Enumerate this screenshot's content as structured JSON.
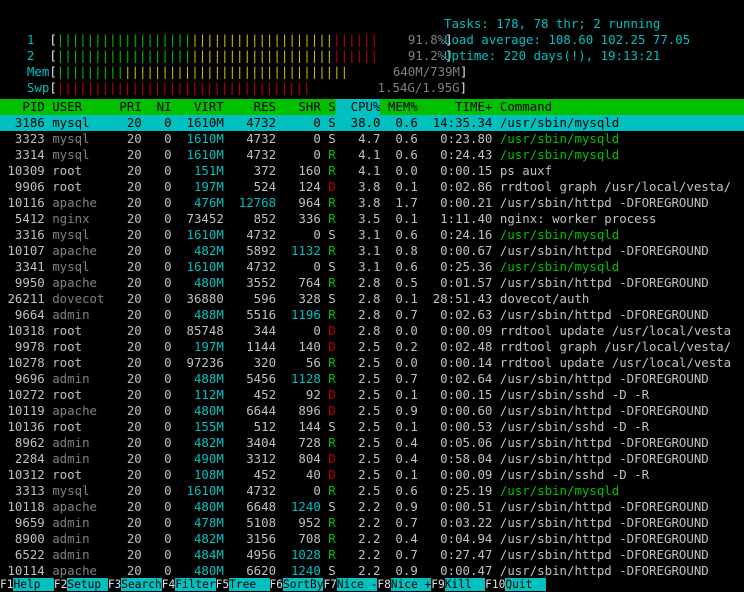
{
  "meters": {
    "cpu1": {
      "label": "1",
      "value": "91.8%",
      "fraction": 0.918
    },
    "cpu2": {
      "label": "2",
      "value": "91.2%",
      "fraction": 0.912
    },
    "mem": {
      "label": "Mem",
      "value": "640M/739M",
      "fraction": 0.866
    },
    "swp": {
      "label": "Swp",
      "value": "1.54G/1.95G",
      "fraction": 0.79
    }
  },
  "summary": {
    "tasks": "Tasks: 178, 78 thr; 2 running",
    "load": "Load average: 108.60 102.25 77.05",
    "uptime": "Uptime: 220 days(!), 19:13:21"
  },
  "columns": [
    "PID",
    "USER",
    "PRI",
    "NI",
    "VIRT",
    "RES",
    "SHR",
    "S",
    "CPU%",
    "MEM%",
    "TIME+",
    "Command"
  ],
  "processes": [
    {
      "pid": "3186",
      "user": "mysql",
      "pri": "20",
      "ni": "0",
      "virt": "1610M",
      "res": "4732",
      "shr": "0",
      "s": "S",
      "cpu": "38.0",
      "mem": "0.6",
      "time": "14:35.34",
      "cmd": "/usr/sbin/mysqld",
      "selected": true
    },
    {
      "pid": "3323",
      "user": "mysql",
      "pri": "20",
      "ni": "0",
      "virt": "1610M",
      "res": "4732",
      "shr": "0",
      "s": "S",
      "cpu": "4.7",
      "mem": "0.6",
      "time": "0:23.80",
      "cmd": "/usr/sbin/mysqld",
      "thread": true
    },
    {
      "pid": "3314",
      "user": "mysql",
      "pri": "20",
      "ni": "0",
      "virt": "1610M",
      "res": "4732",
      "shr": "0",
      "s": "R",
      "cpu": "4.1",
      "mem": "0.6",
      "time": "0:24.43",
      "cmd": "/usr/sbin/mysqld",
      "thread": true
    },
    {
      "pid": "10309",
      "user": "root",
      "pri": "20",
      "ni": "0",
      "virt": "151M",
      "res": "372",
      "shr": "160",
      "s": "R",
      "cpu": "4.1",
      "mem": "0.0",
      "time": "0:00.15",
      "cmd": "ps auxf"
    },
    {
      "pid": "9906",
      "user": "root",
      "pri": "20",
      "ni": "0",
      "virt": "197M",
      "res": "524",
      "shr": "124",
      "s": "D",
      "cpu": "3.8",
      "mem": "0.1",
      "time": "0:02.86",
      "cmd": "rrdtool graph /usr/local/vesta/"
    },
    {
      "pid": "10116",
      "user": "apache",
      "pri": "20",
      "ni": "0",
      "virt": "476M",
      "res": "12768",
      "shr": "964",
      "s": "R",
      "cpu": "3.8",
      "mem": "1.7",
      "time": "0:00.21",
      "cmd": "/usr/sbin/httpd -DFOREGROUND"
    },
    {
      "pid": "5412",
      "user": "nginx",
      "pri": "20",
      "ni": "0",
      "virt": "73452",
      "res": "852",
      "shr": "336",
      "s": "R",
      "cpu": "3.5",
      "mem": "0.1",
      "time": "1:11.40",
      "cmd": "nginx: worker process"
    },
    {
      "pid": "3316",
      "user": "mysql",
      "pri": "20",
      "ni": "0",
      "virt": "1610M",
      "res": "4732",
      "shr": "0",
      "s": "S",
      "cpu": "3.1",
      "mem": "0.6",
      "time": "0:24.16",
      "cmd": "/usr/sbin/mysqld",
      "thread": true
    },
    {
      "pid": "10107",
      "user": "apache",
      "pri": "20",
      "ni": "0",
      "virt": "482M",
      "res": "5892",
      "shr": "1132",
      "s": "R",
      "cpu": "3.1",
      "mem": "0.8",
      "time": "0:00.67",
      "cmd": "/usr/sbin/httpd -DFOREGROUND"
    },
    {
      "pid": "3341",
      "user": "mysql",
      "pri": "20",
      "ni": "0",
      "virt": "1610M",
      "res": "4732",
      "shr": "0",
      "s": "S",
      "cpu": "3.1",
      "mem": "0.6",
      "time": "0:25.36",
      "cmd": "/usr/sbin/mysqld",
      "thread": true
    },
    {
      "pid": "9950",
      "user": "apache",
      "pri": "20",
      "ni": "0",
      "virt": "480M",
      "res": "3552",
      "shr": "764",
      "s": "R",
      "cpu": "2.8",
      "mem": "0.5",
      "time": "0:01.57",
      "cmd": "/usr/sbin/httpd -DFOREGROUND"
    },
    {
      "pid": "26211",
      "user": "dovecot",
      "pri": "20",
      "ni": "0",
      "virt": "36880",
      "res": "596",
      "shr": "328",
      "s": "S",
      "cpu": "2.8",
      "mem": "0.1",
      "time": "28:51.43",
      "cmd": "dovecot/auth"
    },
    {
      "pid": "9664",
      "user": "admin",
      "pri": "20",
      "ni": "0",
      "virt": "488M",
      "res": "5516",
      "shr": "1196",
      "s": "R",
      "cpu": "2.8",
      "mem": "0.7",
      "time": "0:02.63",
      "cmd": "/usr/sbin/httpd -DFOREGROUND"
    },
    {
      "pid": "10318",
      "user": "root",
      "pri": "20",
      "ni": "0",
      "virt": "85748",
      "res": "344",
      "shr": "0",
      "s": "D",
      "cpu": "2.8",
      "mem": "0.0",
      "time": "0:00.09",
      "cmd": "rrdtool update /usr/local/vesta"
    },
    {
      "pid": "9978",
      "user": "root",
      "pri": "20",
      "ni": "0",
      "virt": "197M",
      "res": "1144",
      "shr": "140",
      "s": "D",
      "cpu": "2.5",
      "mem": "0.2",
      "time": "0:02.48",
      "cmd": "rrdtool graph /usr/local/vesta/"
    },
    {
      "pid": "10278",
      "user": "root",
      "pri": "20",
      "ni": "0",
      "virt": "97236",
      "res": "320",
      "shr": "56",
      "s": "R",
      "cpu": "2.5",
      "mem": "0.0",
      "time": "0:00.14",
      "cmd": "rrdtool update /usr/local/vesta"
    },
    {
      "pid": "9696",
      "user": "admin",
      "pri": "20",
      "ni": "0",
      "virt": "488M",
      "res": "5456",
      "shr": "1128",
      "s": "R",
      "cpu": "2.5",
      "mem": "0.7",
      "time": "0:02.64",
      "cmd": "/usr/sbin/httpd -DFOREGROUND"
    },
    {
      "pid": "10272",
      "user": "root",
      "pri": "20",
      "ni": "0",
      "virt": "112M",
      "res": "452",
      "shr": "92",
      "s": "D",
      "cpu": "2.5",
      "mem": "0.1",
      "time": "0:00.15",
      "cmd": "/usr/sbin/sshd -D -R"
    },
    {
      "pid": "10119",
      "user": "apache",
      "pri": "20",
      "ni": "0",
      "virt": "480M",
      "res": "6644",
      "shr": "896",
      "s": "D",
      "cpu": "2.5",
      "mem": "0.9",
      "time": "0:00.60",
      "cmd": "/usr/sbin/httpd -DFOREGROUND"
    },
    {
      "pid": "10136",
      "user": "root",
      "pri": "20",
      "ni": "0",
      "virt": "155M",
      "res": "512",
      "shr": "144",
      "s": "S",
      "cpu": "2.5",
      "mem": "0.1",
      "time": "0:00.53",
      "cmd": "/usr/sbin/sshd -D -R"
    },
    {
      "pid": "8962",
      "user": "admin",
      "pri": "20",
      "ni": "0",
      "virt": "482M",
      "res": "3404",
      "shr": "728",
      "s": "R",
      "cpu": "2.5",
      "mem": "0.4",
      "time": "0:05.06",
      "cmd": "/usr/sbin/httpd -DFOREGROUND"
    },
    {
      "pid": "2284",
      "user": "admin",
      "pri": "20",
      "ni": "0",
      "virt": "490M",
      "res": "3312",
      "shr": "804",
      "s": "D",
      "cpu": "2.5",
      "mem": "0.4",
      "time": "0:58.04",
      "cmd": "/usr/sbin/httpd -DFOREGROUND"
    },
    {
      "pid": "10312",
      "user": "root",
      "pri": "20",
      "ni": "0",
      "virt": "108M",
      "res": "452",
      "shr": "40",
      "s": "D",
      "cpu": "2.5",
      "mem": "0.1",
      "time": "0:00.09",
      "cmd": "/usr/sbin/sshd -D -R"
    },
    {
      "pid": "3313",
      "user": "mysql",
      "pri": "20",
      "ni": "0",
      "virt": "1610M",
      "res": "4732",
      "shr": "0",
      "s": "R",
      "cpu": "2.5",
      "mem": "0.6",
      "time": "0:25.19",
      "cmd": "/usr/sbin/mysqld",
      "thread": true
    },
    {
      "pid": "10118",
      "user": "apache",
      "pri": "20",
      "ni": "0",
      "virt": "480M",
      "res": "6648",
      "shr": "1240",
      "s": "S",
      "cpu": "2.2",
      "mem": "0.9",
      "time": "0:00.51",
      "cmd": "/usr/sbin/httpd -DFOREGROUND"
    },
    {
      "pid": "9659",
      "user": "admin",
      "pri": "20",
      "ni": "0",
      "virt": "478M",
      "res": "5108",
      "shr": "952",
      "s": "R",
      "cpu": "2.2",
      "mem": "0.7",
      "time": "0:03.22",
      "cmd": "/usr/sbin/httpd -DFOREGROUND"
    },
    {
      "pid": "8900",
      "user": "admin",
      "pri": "20",
      "ni": "0",
      "virt": "482M",
      "res": "3156",
      "shr": "708",
      "s": "R",
      "cpu": "2.2",
      "mem": "0.4",
      "time": "0:04.94",
      "cmd": "/usr/sbin/httpd -DFOREGROUND"
    },
    {
      "pid": "6522",
      "user": "admin",
      "pri": "20",
      "ni": "0",
      "virt": "484M",
      "res": "4956",
      "shr": "1028",
      "s": "R",
      "cpu": "2.2",
      "mem": "0.7",
      "time": "0:27.47",
      "cmd": "/usr/sbin/httpd -DFOREGROUND"
    },
    {
      "pid": "10114",
      "user": "apache",
      "pri": "20",
      "ni": "0",
      "virt": "480M",
      "res": "6620",
      "shr": "1240",
      "s": "S",
      "cpu": "2.2",
      "mem": "0.9",
      "time": "0:00.47",
      "cmd": "/usr/sbin/httpd -DFOREGROUND"
    }
  ],
  "footer": [
    {
      "key": "F1",
      "label": "Help"
    },
    {
      "key": "F2",
      "label": "Setup"
    },
    {
      "key": "F3",
      "label": "Search"
    },
    {
      "key": "F4",
      "label": "Filter"
    },
    {
      "key": "F5",
      "label": "Tree"
    },
    {
      "key": "F6",
      "label": "SortBy"
    },
    {
      "key": "F7",
      "label": "Nice -"
    },
    {
      "key": "F8",
      "label": "Nice +"
    },
    {
      "key": "F9",
      "label": "Kill"
    },
    {
      "key": "F10",
      "label": "Quit"
    }
  ],
  "colors": {
    "header_bg": "#00c000",
    "selected_bg": "#00c0c0",
    "meter_green": "#00c000",
    "meter_red": "#c00000",
    "meter_label": "#00c0c0"
  }
}
